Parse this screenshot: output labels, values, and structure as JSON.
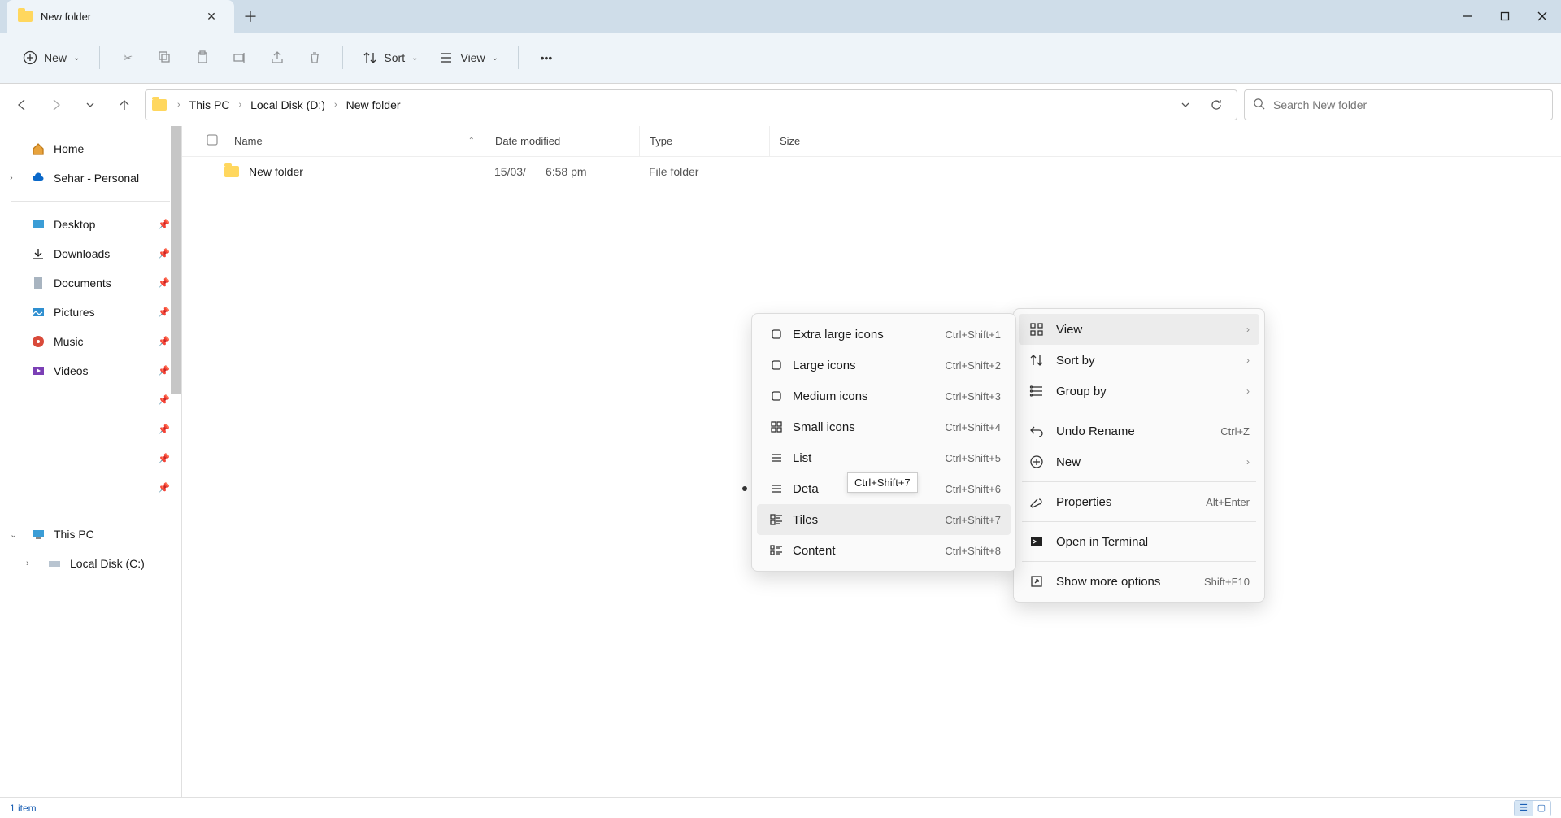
{
  "tab": {
    "title": "New folder"
  },
  "toolbar": {
    "new": "New",
    "sort": "Sort",
    "view": "View"
  },
  "breadcrumbs": [
    "This PC",
    "Local Disk (D:)",
    "New folder"
  ],
  "search": {
    "placeholder": "Search New folder"
  },
  "columns": {
    "name": "Name",
    "date": "Date modified",
    "type": "Type",
    "size": "Size"
  },
  "rows": [
    {
      "name": "New folder",
      "date1": "15/03/",
      "date2": "6:58 pm",
      "type": "File folder",
      "size": ""
    }
  ],
  "sidebar": {
    "home": "Home",
    "onedrive": "Sehar - Personal",
    "pinned": [
      "Desktop",
      "Downloads",
      "Documents",
      "Pictures",
      "Music",
      "Videos"
    ],
    "thispc": "This PC",
    "localc": "Local Disk (C:)"
  },
  "status": {
    "count": "1 item"
  },
  "context_main": [
    {
      "id": "view",
      "label": "View",
      "sub": true,
      "icon": "grid",
      "hover": true
    },
    {
      "id": "sortby",
      "label": "Sort by",
      "sub": true,
      "icon": "sort"
    },
    {
      "id": "groupby",
      "label": "Group by",
      "sub": true,
      "icon": "group"
    },
    {
      "sep": true
    },
    {
      "id": "undo",
      "label": "Undo Rename",
      "kbd": "Ctrl+Z",
      "icon": "undo"
    },
    {
      "id": "new",
      "label": "New",
      "sub": true,
      "icon": "plus"
    },
    {
      "sep": true
    },
    {
      "id": "props",
      "label": "Properties",
      "kbd": "Alt+Enter",
      "icon": "wrench"
    },
    {
      "sep": true
    },
    {
      "id": "terminal",
      "label": "Open in Terminal",
      "icon": "terminal"
    },
    {
      "sep": true
    },
    {
      "id": "more",
      "label": "Show more options",
      "kbd": "Shift+F10",
      "icon": "expand"
    }
  ],
  "context_view": [
    {
      "id": "xl",
      "label": "Extra large icons",
      "kbd": "Ctrl+Shift+1",
      "icon": "sq"
    },
    {
      "id": "lg",
      "label": "Large icons",
      "kbd": "Ctrl+Shift+2",
      "icon": "sq"
    },
    {
      "id": "md",
      "label": "Medium icons",
      "kbd": "Ctrl+Shift+3",
      "icon": "sq"
    },
    {
      "id": "sm",
      "label": "Small icons",
      "kbd": "Ctrl+Shift+4",
      "icon": "grid4"
    },
    {
      "id": "list",
      "label": "List",
      "kbd": "Ctrl+Shift+5",
      "icon": "list"
    },
    {
      "id": "details",
      "label": "Deta",
      "kbd": "Ctrl+Shift+6",
      "icon": "list",
      "selected": true
    },
    {
      "id": "tiles",
      "label": "Tiles",
      "kbd": "Ctrl+Shift+7",
      "icon": "tiles",
      "hover": true
    },
    {
      "id": "content",
      "label": "Content",
      "kbd": "Ctrl+Shift+8",
      "icon": "content"
    }
  ],
  "tooltip": "Ctrl+Shift+7"
}
